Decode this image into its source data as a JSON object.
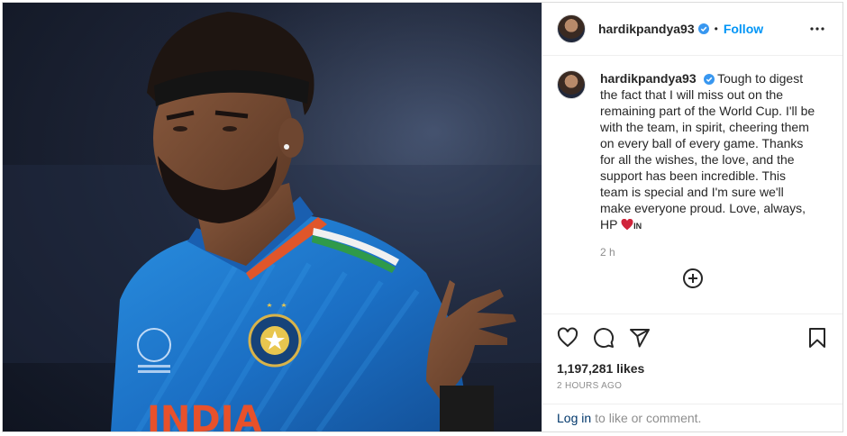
{
  "post": {
    "username": "hardikpandya93",
    "follow_label": "Follow",
    "separator": "•",
    "caption_text": "Tough to digest the fact that I will miss out on the remaining part of the World Cup. I'll be with the team, in spirit, cheering them on every ball of every game. Thanks for all the wishes, the love, and the support has been incredible. This team is special and I'm sure we'll make everyone proud. Love, always, HP",
    "caption_flag": "IN",
    "caption_time": "2 h",
    "likes": "1,197,281 likes",
    "posted_ago": "2 HOURS AGO",
    "image_jersey_text": "INDIA"
  },
  "footer": {
    "login_link": "Log in",
    "login_suffix": "to like or comment."
  },
  "icons": {
    "verified": "verified-badge-icon",
    "more": "more-options-icon",
    "load_more": "plus-circle-icon",
    "like": "heart-icon",
    "comment": "comment-icon",
    "share": "share-icon",
    "save": "bookmark-icon",
    "heart_emoji": "red-heart-emoji"
  },
  "colors": {
    "accent": "#0095f6",
    "verified": "#3897f0",
    "link": "#00376b",
    "muted": "#8e8e8e",
    "heart": "#ed4956",
    "jersey": "#1f7fd0"
  }
}
